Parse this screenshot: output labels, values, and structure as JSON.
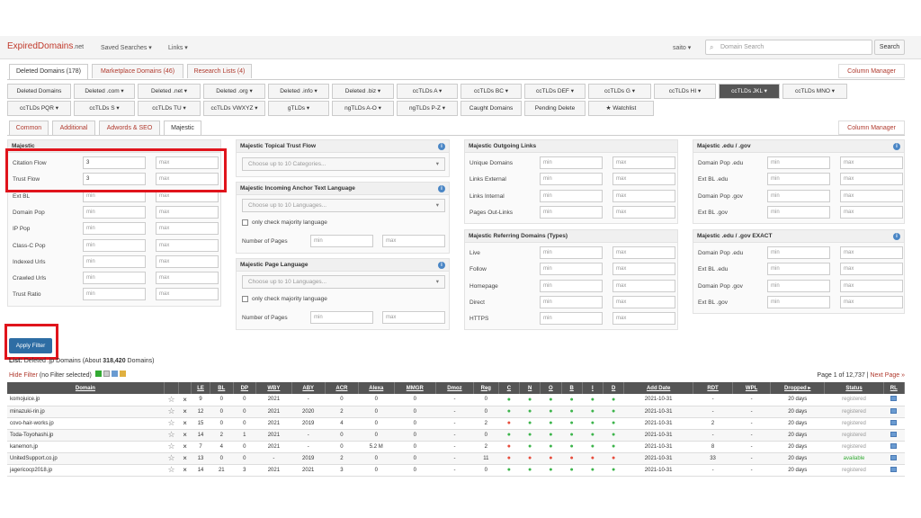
{
  "topnav": {
    "logo_main": "ExpiredDomains",
    "logo_suffix": ".net",
    "saved_searches": "Saved Searches ▾",
    "links": "Links ▾",
    "user": "saito ▾",
    "search_placeholder": "Domain Search",
    "search_button": "Search"
  },
  "tabs": [
    "Deleted Domains (178)",
    "Marketplace Domains (46)",
    "Research Lists (4)"
  ],
  "column_manager": "Column Manager",
  "tld_buttons_row1": [
    "Deleted Domains",
    "Deleted .com ▾",
    "Deleted .net ▾",
    "Deleted .org ▾",
    "Deleted .info ▾",
    "Deleted .biz ▾",
    "ccTLDs A ▾",
    "ccTLDs BC ▾",
    "ccTLDs DEF ▾",
    "ccTLDs G ▾",
    "ccTLDs HI ▾",
    "ccTLDs JKL ▾",
    "ccTLDs MNO ▾"
  ],
  "tld_buttons_row2": [
    "ccTLDs PQR ▾",
    "ccTLDs S ▾",
    "ccTLDs TU ▾",
    "ccTLDs VWXYZ ▾",
    "gTLDs ▾",
    "ngTLDs A-O ▾",
    "ngTLDs P-Z ▾",
    "Caught Domains",
    "Pending Delete",
    "★ Watchlist"
  ],
  "filter_tabs": [
    "Common",
    "Additional",
    "Adwords & SEO",
    "Majestic"
  ],
  "majestic": {
    "title": "Majestic",
    "rows": [
      {
        "label": "Citation Flow",
        "min": "3",
        "max": "max"
      },
      {
        "label": "Trust Flow",
        "min": "3",
        "max": "max"
      },
      {
        "label": "Ext BL",
        "min": "min",
        "max": "max"
      },
      {
        "label": "Domain Pop",
        "min": "min",
        "max": "max"
      },
      {
        "label": "IP Pop",
        "min": "min",
        "max": "max"
      },
      {
        "label": "Class-C Pop",
        "min": "min",
        "max": "max"
      },
      {
        "label": "Indexed Urls",
        "min": "min",
        "max": "max"
      },
      {
        "label": "Crawled Urls",
        "min": "min",
        "max": "max"
      },
      {
        "label": "Trust Ratio",
        "min": "min",
        "max": "max"
      }
    ]
  },
  "topical": {
    "title": "Majestic Topical Trust Flow",
    "select": "Choose up to 10 Categories..."
  },
  "anchor": {
    "title": "Majestic Incoming Anchor Text Language",
    "select": "Choose up to 10 Languages...",
    "checkbox": "only check majority language",
    "pages_label": "Number of Pages",
    "min": "min",
    "max": "max"
  },
  "pagelang": {
    "title": "Majestic Page Language",
    "select": "Choose up to 10 Languages...",
    "checkbox": "only check majority language",
    "pages_label": "Number of Pages",
    "min": "min",
    "max": "max"
  },
  "outgoing": {
    "title": "Majestic Outgoing Links",
    "rows": [
      {
        "label": "Unique Domains",
        "min": "min",
        "max": "max"
      },
      {
        "label": "Links External",
        "min": "min",
        "max": "max"
      },
      {
        "label": "Links Internal",
        "min": "min",
        "max": "max"
      },
      {
        "label": "Pages Out-Links",
        "min": "min",
        "max": "max"
      }
    ]
  },
  "referring": {
    "title": "Majestic Referring Domains (Types)",
    "rows": [
      {
        "label": "Live",
        "min": "min",
        "max": "max"
      },
      {
        "label": "Follow",
        "min": "min",
        "max": "max"
      },
      {
        "label": "Homepage",
        "min": "min",
        "max": "max"
      },
      {
        "label": "Direct",
        "min": "min",
        "max": "max"
      },
      {
        "label": "HTTPS",
        "min": "min",
        "max": "max"
      }
    ]
  },
  "edugov": {
    "title": "Majestic .edu / .gov",
    "rows": [
      {
        "label": "Domain Pop .edu",
        "min": "min",
        "max": "max"
      },
      {
        "label": "Ext BL .edu",
        "min": "min",
        "max": "max"
      },
      {
        "label": "Domain Pop .gov",
        "min": "min",
        "max": "max"
      },
      {
        "label": "Ext BL .gov",
        "min": "min",
        "max": "max"
      }
    ]
  },
  "edugov_exact": {
    "title": "Majestic .edu / .gov EXACT",
    "rows": [
      {
        "label": "Domain Pop .edu",
        "min": "min",
        "max": "max"
      },
      {
        "label": "Ext BL .edu",
        "min": "min",
        "max": "max"
      },
      {
        "label": "Domain Pop .gov",
        "min": "min",
        "max": "max"
      },
      {
        "label": "Ext BL .gov",
        "min": "min",
        "max": "max"
      }
    ]
  },
  "apply_filter": "Apply Filter",
  "list": {
    "prefix": "List:",
    "text": " Deleted .jp Domains (About ",
    "count": "318,420",
    "suffix": " Domains)",
    "hide_filter": "Hide Filter",
    "no_filter": " (no Filter selected)",
    "page_info": "Page 1 of 12,737 | ",
    "next": "Next Page »"
  },
  "table": {
    "headers": [
      "Domain",
      "",
      "",
      "LE",
      "BL",
      "DP",
      "WBY",
      "ABY",
      "ACR",
      "Alexa",
      "MMGR",
      "Dmoz",
      "Reg",
      "C",
      "N",
      "O",
      "B",
      "I",
      "D",
      "Add Date",
      "RDT",
      "WPL",
      "Dropped ▸",
      "Status",
      "RL"
    ],
    "rows": [
      {
        "domain": "komojuice.jp",
        "le": "9",
        "bl": "0",
        "dp": "0",
        "wby": "2021",
        "aby": "-",
        "acr": "0",
        "alexa": "0",
        "mmgr": "0",
        "dmoz": "-",
        "reg": "0",
        "dots": "gggggg",
        "add": "2021-10-31",
        "rdt": "-",
        "wpl": "-",
        "dropped": "20 days",
        "status": "registered"
      },
      {
        "domain": "minazuki-rin.jp",
        "le": "12",
        "bl": "0",
        "dp": "0",
        "wby": "2021",
        "aby": "2020",
        "acr": "2",
        "alexa": "0",
        "mmgr": "0",
        "dmoz": "-",
        "reg": "0",
        "dots": "gggggg",
        "add": "2021-10-31",
        "rdt": "-",
        "wpl": "-",
        "dropped": "20 days",
        "status": "registered"
      },
      {
        "domain": "covo-hair-works.jp",
        "le": "15",
        "bl": "0",
        "dp": "0",
        "wby": "2021",
        "aby": "2019",
        "acr": "4",
        "alexa": "0",
        "mmgr": "0",
        "dmoz": "-",
        "reg": "2",
        "dots": "rggggg",
        "add": "2021-10-31",
        "rdt": "2",
        "wpl": "-",
        "dropped": "20 days",
        "status": "registered"
      },
      {
        "domain": "Toda-Toyohashi.jp",
        "le": "14",
        "bl": "2",
        "dp": "1",
        "wby": "2021",
        "aby": "-",
        "acr": "0",
        "alexa": "0",
        "mmgr": "0",
        "dmoz": "-",
        "reg": "0",
        "dots": "gggggg",
        "add": "2021-10-31",
        "rdt": "-",
        "wpl": "-",
        "dropped": "20 days",
        "status": "registered"
      },
      {
        "domain": "kanemon.jp",
        "le": "7",
        "bl": "4",
        "dp": "0",
        "wby": "2021",
        "aby": "-",
        "acr": "0",
        "alexa": "5.2 M",
        "mmgr": "0",
        "dmoz": "-",
        "reg": "2",
        "dots": "rggggg",
        "add": "2021-10-31",
        "rdt": "8",
        "wpl": "-",
        "dropped": "20 days",
        "status": "registered"
      },
      {
        "domain": "UnitedSupport.co.jp",
        "le": "13",
        "bl": "0",
        "dp": "0",
        "wby": "-",
        "aby": "2019",
        "acr": "2",
        "alexa": "0",
        "mmgr": "0",
        "dmoz": "-",
        "reg": "11",
        "dots": "rrrrrr",
        "add": "2021-10-31",
        "rdt": "33",
        "wpl": "-",
        "dropped": "20 days",
        "status": "available"
      },
      {
        "domain": "jagericocp2018.jp",
        "le": "14",
        "bl": "21",
        "dp": "3",
        "wby": "2021",
        "aby": "2021",
        "acr": "3",
        "alexa": "0",
        "mmgr": "0",
        "dmoz": "-",
        "reg": "0",
        "dots": "gggggg",
        "add": "2021-10-31",
        "rdt": "-",
        "wpl": "-",
        "dropped": "20 days",
        "status": "registered"
      }
    ]
  }
}
